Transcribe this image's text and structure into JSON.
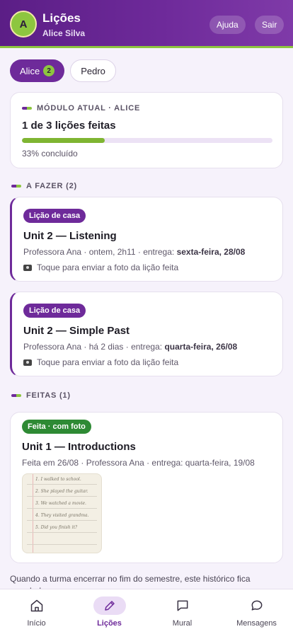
{
  "header": {
    "avatar_initial": "A",
    "title": "Lições",
    "subtitle": "Alice Silva",
    "help_label": "Ajuda",
    "logout_label": "Sair"
  },
  "students": [
    {
      "name": "Alice",
      "badge": "2",
      "active": true
    },
    {
      "name": "Pedro",
      "active": false
    }
  ],
  "module": {
    "label": "MÓDULO ATUAL · ALICE",
    "progress_text": "1 de 3 lições feitas",
    "percent": 33,
    "percent_text": "33% concluído"
  },
  "todo": {
    "heading": "A FAZER (2)",
    "items": [
      {
        "tag": "Lição de casa",
        "title": "Unit 2 — Listening",
        "meta_prefix": "Professora Ana · ontem, 2h11 · entrega: ",
        "due": "sexta-feira, 28/08",
        "action": "Toque para enviar a foto da lição feita"
      },
      {
        "tag": "Lição de casa",
        "title": "Unit 2 — Simple Past",
        "meta_prefix": "Professora Ana · há 2 dias · entrega: ",
        "due": "quarta-feira, 26/08",
        "action": "Toque para enviar a foto da lição feita"
      }
    ]
  },
  "done": {
    "heading": "FEITAS (1)",
    "items": [
      {
        "tag": "Feita · com foto",
        "title": "Unit 1 — Introductions",
        "meta": "Feita em 26/08 · Professora Ana · entrega: quarta-feira, 19/08",
        "photo_lines": [
          "1. I walked to school.",
          "2. She played the guitar.",
          "3. We watched a movie.",
          "4. They visited grandma.",
          "5. Did you finish it?"
        ]
      }
    ]
  },
  "footnote": "Quando a turma encerrar no fim do semestre, este histórico fica guardado",
  "nav": [
    {
      "label": "Início",
      "icon": "home-icon",
      "active": false
    },
    {
      "label": "Lições",
      "icon": "pencil-icon",
      "active": true
    },
    {
      "label": "Mural",
      "icon": "board-icon",
      "active": false
    },
    {
      "label": "Mensagens",
      "icon": "chat-icon",
      "active": false
    }
  ],
  "colors": {
    "primary": "#6e2a9a",
    "accent": "#8dc63f",
    "done_green": "#2e8a34"
  }
}
